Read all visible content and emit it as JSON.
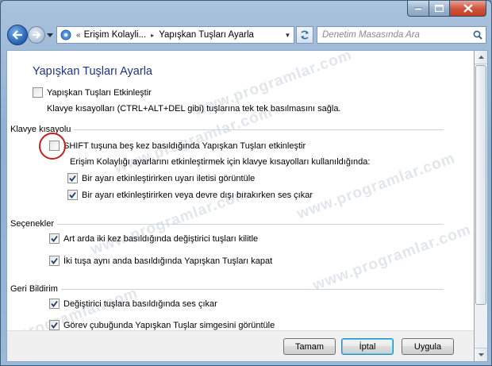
{
  "window": {
    "caption_buttons": {
      "minimize_icon": "minimize-icon",
      "maximize_icon": "maximize-icon",
      "close_icon": "close-icon"
    }
  },
  "nav": {
    "back_icon": "back-arrow-icon",
    "forward_icon": "forward-arrow-icon",
    "breadcrumb_prefix": "«",
    "breadcrumbs": [
      "Erişim Kolayli...",
      "Yapışkan Tuşları Ayarla"
    ],
    "breadcrumb_separator": "▸",
    "search_placeholder": "Denetim Masasında Ara"
  },
  "page": {
    "title": "Yapışkan Tuşları Ayarla",
    "enable_sticky": {
      "label": "Yapışkan Tuşları Etkinleştir",
      "checked": false
    },
    "enable_sticky_desc": "Klavye kısayolları (CTRL+ALT+DEL gibi) tuşlarına tek tek basılmasını sağla.",
    "keyboard_shortcut": {
      "group_label": "Klavye kısayolu",
      "shift_five": {
        "label": "SHIFT tuşuna beş kez basıldığında Yapışkan Tuşları etkinleştir",
        "checked": false
      },
      "sub_desc": "Erişim Kolaylığı ayarlarını etkinleştirmek için klavye kısayolları kullanıldığında:",
      "warning_msg": {
        "label": "Bir ayarı etkinleştirirken uyarı iletisi görüntüle",
        "checked": true
      },
      "sound": {
        "label": "Bir ayarı etkinleştirirken veya devre dışı bırakırken ses çıkar",
        "checked": true
      }
    },
    "options": {
      "group_label": "Seçenekler",
      "lock_modifier": {
        "label": "Art arda iki kez basıldığında değiştirici tuşları kilitle",
        "checked": true
      },
      "turn_off": {
        "label": "İki tuşa aynı anda basıldığında Yapışkan Tuşları kapat",
        "checked": true
      }
    },
    "feedback": {
      "group_label": "Geri Bildirim",
      "modifier_sound": {
        "label": "Değiştirici tuşlara basıldığında ses çıkar",
        "checked": true
      },
      "taskbar_icon": {
        "label": "Görev çubuğunda Yapışkan Tuşlar simgesini görüntüle",
        "checked": true
      }
    }
  },
  "buttons": {
    "ok": "Tamam",
    "cancel": "İptal",
    "apply": "Uygula"
  },
  "watermark": "www.programlar.com",
  "colors": {
    "title": "#1e3287",
    "highlight_circle": "#cc1b1b"
  }
}
